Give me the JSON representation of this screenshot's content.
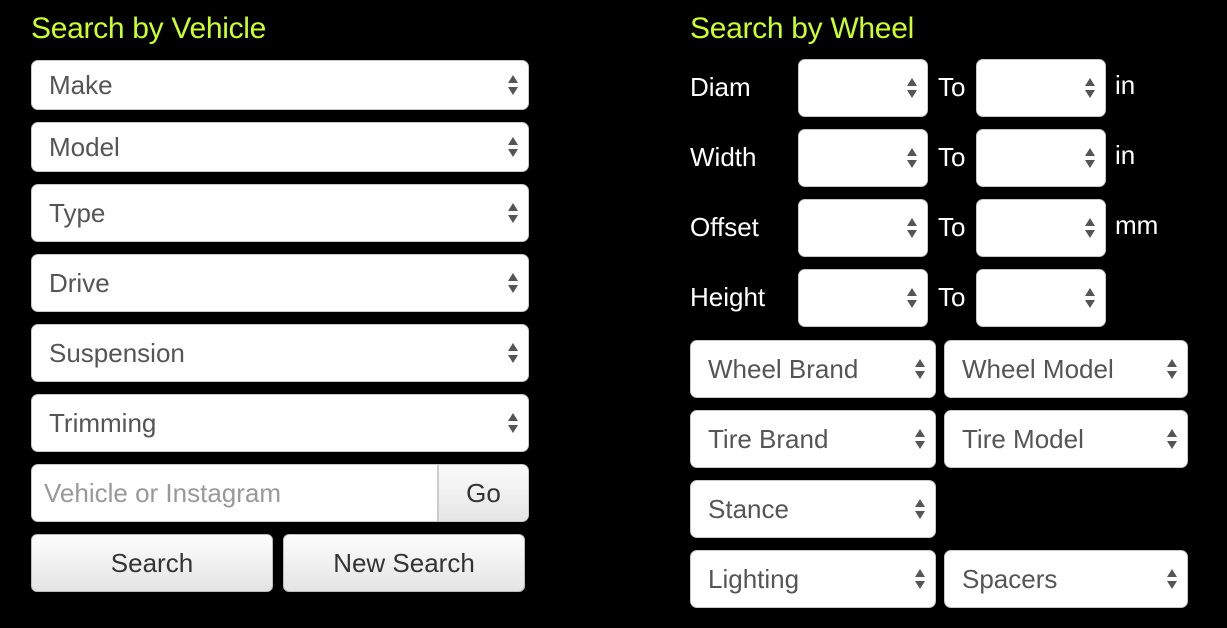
{
  "vehicle": {
    "title": "Search by Vehicle",
    "selects": [
      "Make",
      "Model",
      "Type",
      "Drive",
      "Suspension",
      "Trimming"
    ],
    "search_placeholder": "Vehicle or Instagram",
    "go_label": "Go",
    "search_label": "Search",
    "new_search_label": "New Search"
  },
  "wheel": {
    "title": "Search by Wheel",
    "ranges": [
      {
        "label": "Diam",
        "to": "To",
        "unit": "in"
      },
      {
        "label": "Width",
        "to": "To",
        "unit": "in"
      },
      {
        "label": "Offset",
        "to": "To",
        "unit": "mm"
      },
      {
        "label": "Height",
        "to": "To",
        "unit": ""
      }
    ],
    "selects": [
      "Wheel Brand",
      "Wheel Model",
      "Tire Brand",
      "Tire Model",
      "Stance",
      "Lighting",
      "Spacers"
    ]
  },
  "colors": {
    "accent": "#ccff22",
    "background": "#000000"
  }
}
